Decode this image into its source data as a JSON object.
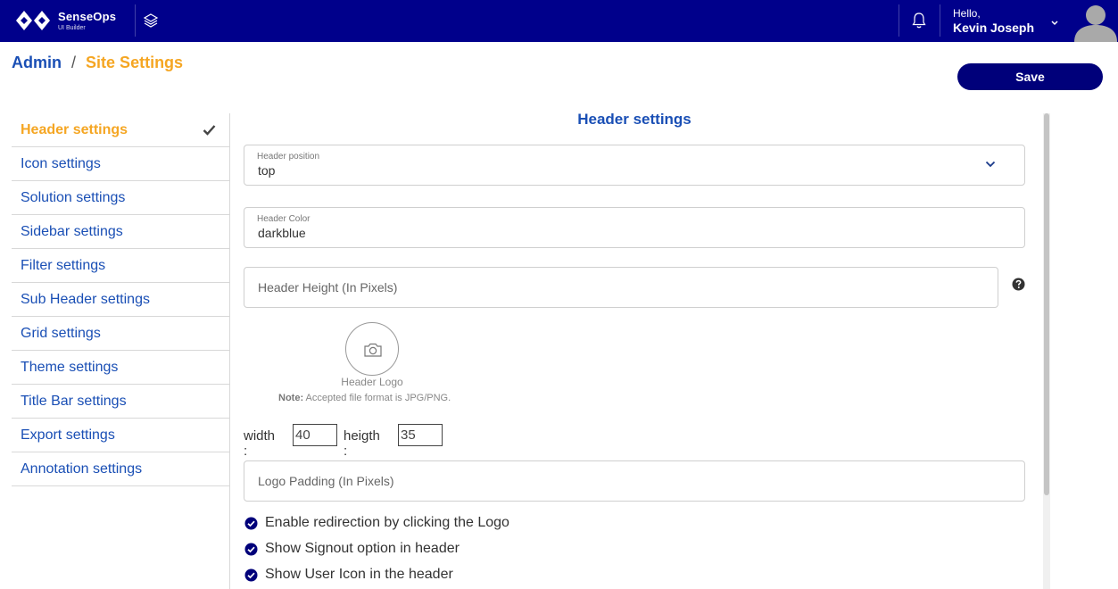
{
  "header": {
    "brand_name": "SenseOps",
    "brand_subtitle": "UI Builder",
    "greeting": "Hello,",
    "user_name": "Kevin Joseph",
    "background_color": "#00008b"
  },
  "breadcrumb": {
    "root": "Admin",
    "separator": "/",
    "current": "Site Settings"
  },
  "toolbar": {
    "save_label": "Save"
  },
  "sidebar": {
    "items": [
      {
        "label": "Header settings",
        "active": true
      },
      {
        "label": "Icon settings"
      },
      {
        "label": "Solution settings"
      },
      {
        "label": "Sidebar settings"
      },
      {
        "label": "Filter settings"
      },
      {
        "label": "Sub Header settings"
      },
      {
        "label": "Grid settings"
      },
      {
        "label": "Theme settings"
      },
      {
        "label": "Title Bar settings"
      },
      {
        "label": "Export settings"
      },
      {
        "label": "Annotation settings"
      }
    ]
  },
  "main": {
    "title": "Header settings",
    "header_position": {
      "label": "Header position",
      "value": "top"
    },
    "header_color": {
      "label": "Header Color",
      "value": "darkblue"
    },
    "header_height": {
      "placeholder": "Header Height (In Pixels)"
    },
    "logo": {
      "caption": "Header Logo",
      "note_prefix": "Note:",
      "note_text": " Accepted file format is JPG/PNG."
    },
    "dimensions": {
      "width_label": "width :",
      "width_value": "40",
      "height_label": "heigth :",
      "height_value": "35"
    },
    "logo_padding": {
      "placeholder": "Logo Padding (In Pixels)"
    },
    "options": [
      {
        "label": "Enable redirection by clicking the Logo",
        "checked": true
      },
      {
        "label": "Show Signout option in header",
        "checked": true
      },
      {
        "label": "Show User Icon in the header",
        "checked": true
      }
    ]
  },
  "colors": {
    "accent_orange": "#f5a623",
    "link_blue": "#1a4fb5",
    "save_button": "#00007a"
  }
}
